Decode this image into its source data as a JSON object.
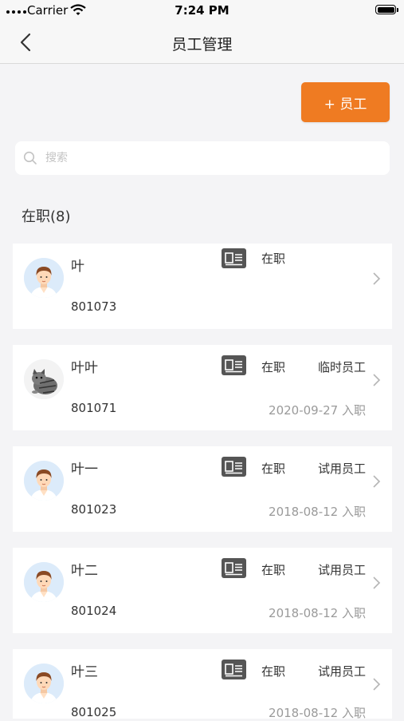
{
  "status_bar": {
    "carrier": "Carrier",
    "time": "7:24 PM"
  },
  "nav": {
    "title": "员工管理"
  },
  "add_button": {
    "label": "+ 员工"
  },
  "search": {
    "placeholder": "搜索"
  },
  "section": {
    "title": "在职(8)"
  },
  "employees": [
    {
      "name": "叶",
      "id": "801073",
      "status": "在职",
      "type": "",
      "date": "",
      "avatar": "man-avatar"
    },
    {
      "name": "叶叶",
      "id": "801071",
      "status": "在职",
      "type": "临时员工",
      "date": "2020-09-27 入职",
      "avatar": "cat-photo"
    },
    {
      "name": "叶一",
      "id": "801023",
      "status": "在职",
      "type": "试用员工",
      "date": "2018-08-12 入职",
      "avatar": "man-avatar"
    },
    {
      "name": "叶二",
      "id": "801024",
      "status": "在职",
      "type": "试用员工",
      "date": "2018-08-12 入职",
      "avatar": "man-avatar"
    },
    {
      "name": "叶三",
      "id": "801025",
      "status": "在职",
      "type": "试用员工",
      "date": "2018-08-12 入职",
      "avatar": "man-avatar"
    }
  ],
  "colors": {
    "accent": "#ef7b22",
    "background": "#f4f4f6",
    "icon_dark": "#555555",
    "muted_text": "#9a9a9a"
  }
}
